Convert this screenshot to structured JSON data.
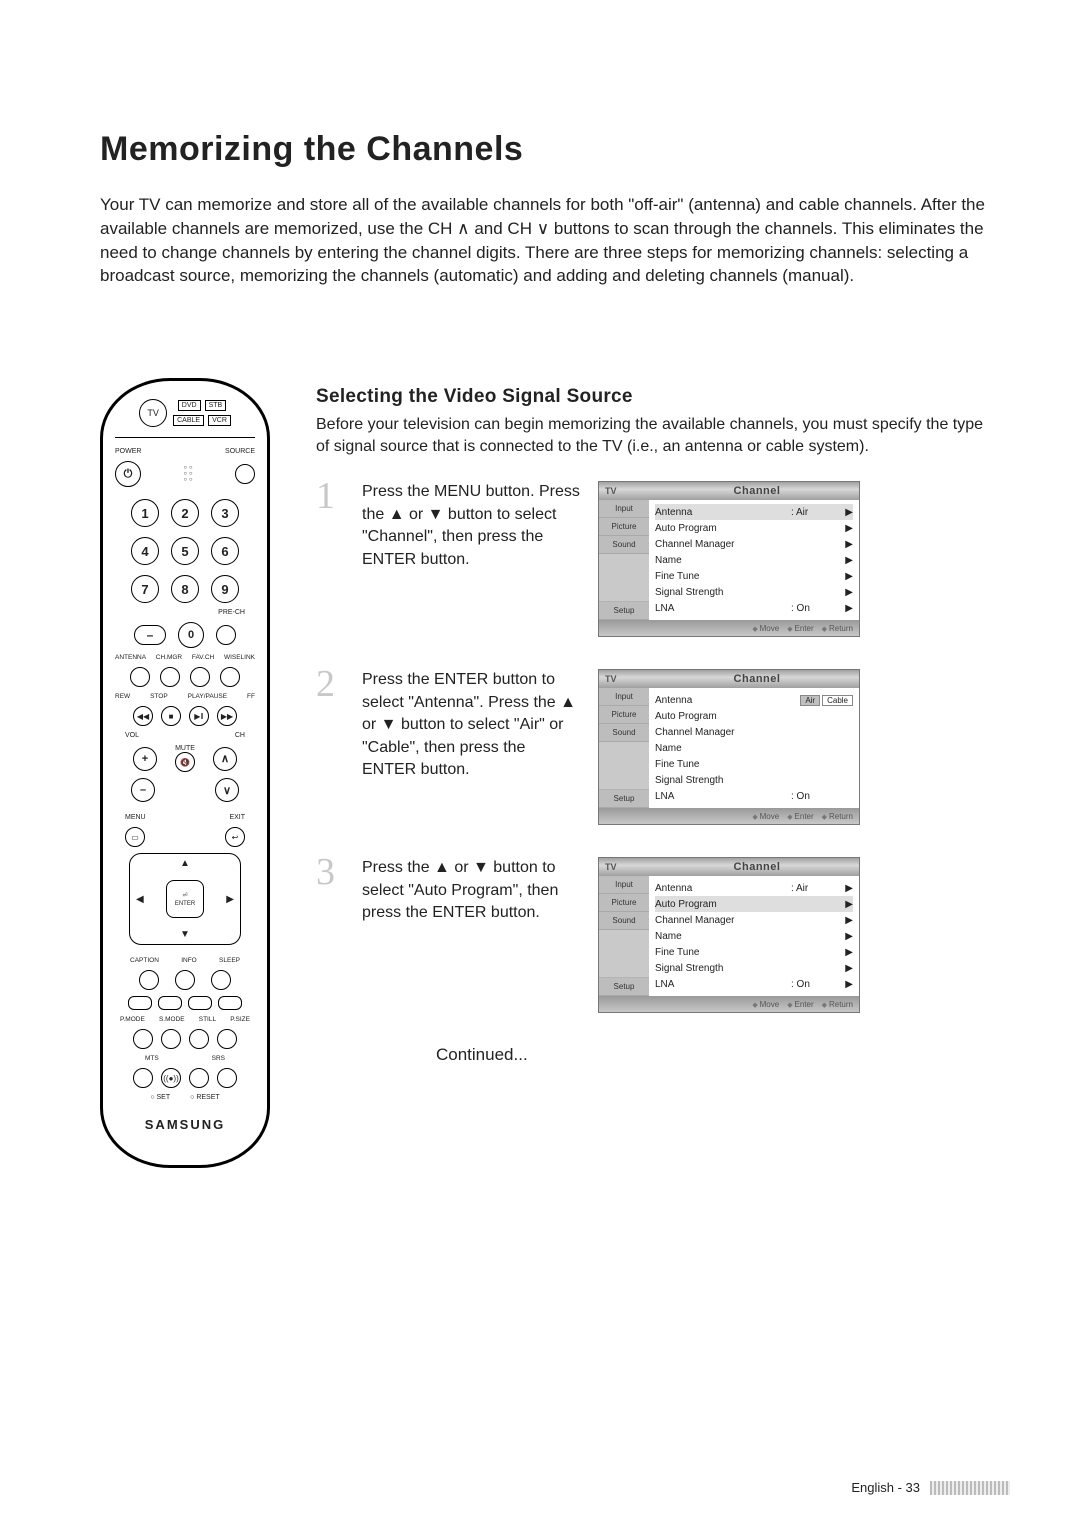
{
  "page": {
    "title": "Memorizing the Channels",
    "intro": "Your TV can memorize and store all of the available channels for both \"off-air\" (antenna) and cable channels. After the available channels are memorized, use the CH ∧ and CH ∨ buttons to scan through the channels. This eliminates the need to change channels by entering the channel digits. There are three steps for memorizing channels: selecting a broadcast source, memorizing the channels (automatic) and adding and deleting channels (manual).",
    "footer": "English - 33"
  },
  "remote": {
    "tv": "TV",
    "modeLabels": [
      "DVD",
      "STB",
      "CABLE",
      "VCR"
    ],
    "power": "POWER",
    "source": "SOURCE",
    "prech": "PRE-CH",
    "rowLabels": [
      "ANTENNA",
      "CH.MGR",
      "FAV.CH",
      "WISELINK"
    ],
    "transport": [
      "REW",
      "STOP",
      "PLAY/PAUSE",
      "FF"
    ],
    "vol": "VOL",
    "ch": "CH",
    "mute": "MUTE",
    "menu": "MENU",
    "exit": "EXIT",
    "enter": "ENTER",
    "bottomRow1": [
      "CAPTION",
      "INFO",
      "SLEEP"
    ],
    "bottomRow2": [
      "P.MODE",
      "S.MODE",
      "STILL",
      "P.SIZE"
    ],
    "bottomRow3": [
      "MTS",
      "SRS"
    ],
    "setreset": [
      "SET",
      "RESET"
    ],
    "brand": "SAMSUNG"
  },
  "section": {
    "heading": "Selecting the Video Signal Source",
    "lead": "Before your television can begin memorizing the available channels, you must specify the type of signal source that is connected to the TV (i.e., an antenna or cable system)."
  },
  "steps": [
    {
      "num": "1",
      "text": "Press the MENU button. Press the ▲ or ▼ button to select \"Channel\", then press the ENTER button.",
      "osd": {
        "tv": "TV",
        "title": "Channel",
        "tabs": [
          "Input",
          "Picture",
          "Sound",
          "",
          "Setup"
        ],
        "rows": [
          {
            "name": "Antenna",
            "val": ": Air",
            "arrow": "▶",
            "sel": true
          },
          {
            "name": "Auto Program",
            "val": "",
            "arrow": "▶"
          },
          {
            "name": "Channel Manager",
            "val": "",
            "arrow": "▶"
          },
          {
            "name": "Name",
            "val": "",
            "arrow": "▶"
          },
          {
            "name": "Fine Tune",
            "val": "",
            "arrow": "▶"
          },
          {
            "name": "Signal Strength",
            "val": "",
            "arrow": "▶"
          },
          {
            "name": "LNA",
            "val": ": On",
            "arrow": "▶"
          }
        ],
        "footer": [
          "Move",
          "Enter",
          "Return"
        ]
      }
    },
    {
      "num": "2",
      "text": "Press the ENTER button to select \"Antenna\". Press the ▲ or ▼ button to select \"Air\" or \"Cable\", then press the ENTER button.",
      "osd": {
        "tv": "TV",
        "title": "Channel",
        "tabs": [
          "Input",
          "Picture",
          "Sound",
          "",
          "Setup"
        ],
        "rows": [
          {
            "name": "Antenna",
            "opts": [
              "Air",
              "Cable"
            ],
            "optsel": 0
          },
          {
            "name": "Auto Program"
          },
          {
            "name": "Channel Manager"
          },
          {
            "name": "Name"
          },
          {
            "name": "Fine Tune"
          },
          {
            "name": "Signal Strength"
          },
          {
            "name": "LNA",
            "val": ": On"
          }
        ],
        "footer": [
          "Move",
          "Enter",
          "Return"
        ]
      }
    },
    {
      "num": "3",
      "text": "Press the ▲ or ▼ button to select \"Auto Program\", then press the ENTER button.",
      "osd": {
        "tv": "TV",
        "title": "Channel",
        "tabs": [
          "Input",
          "Picture",
          "Sound",
          "",
          "Setup"
        ],
        "rows": [
          {
            "name": "Antenna",
            "val": ": Air",
            "arrow": "▶"
          },
          {
            "name": "Auto Program",
            "val": "",
            "arrow": "▶",
            "sel": true
          },
          {
            "name": "Channel Manager",
            "val": "",
            "arrow": "▶"
          },
          {
            "name": "Name",
            "val": "",
            "arrow": "▶"
          },
          {
            "name": "Fine Tune",
            "val": "",
            "arrow": "▶"
          },
          {
            "name": "Signal Strength",
            "val": "",
            "arrow": "▶"
          },
          {
            "name": "LNA",
            "val": ": On",
            "arrow": "▶"
          }
        ],
        "footer": [
          "Move",
          "Enter",
          "Return"
        ]
      }
    }
  ],
  "continued": "Continued..."
}
